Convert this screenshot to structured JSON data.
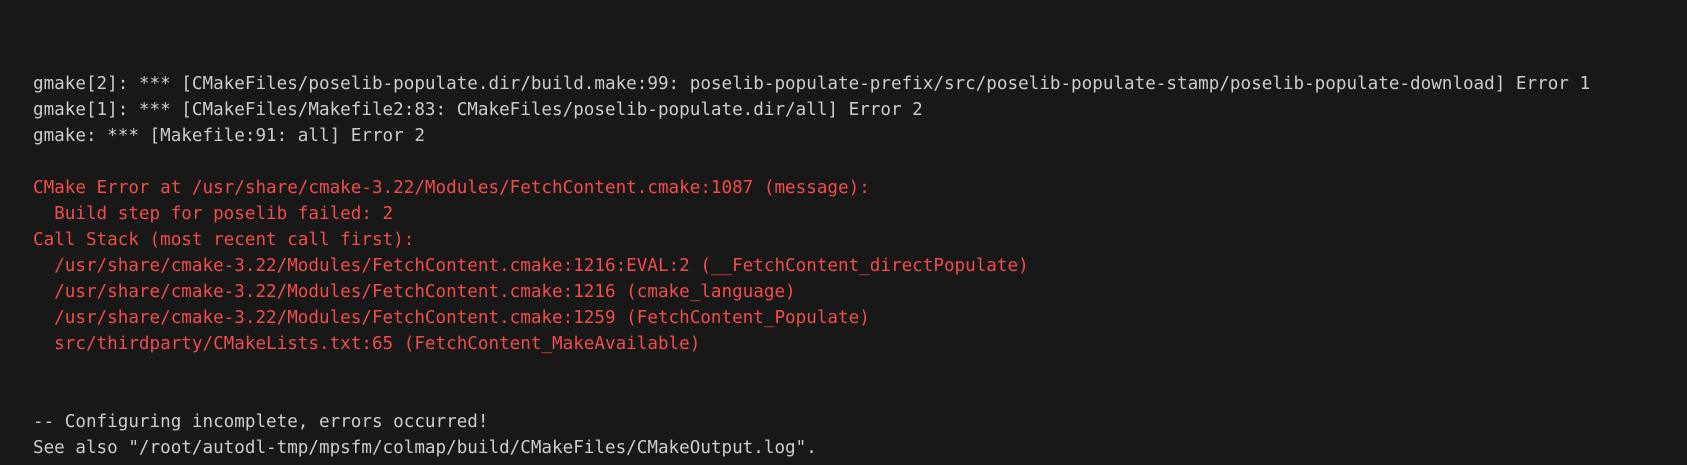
{
  "terminal": {
    "colors": {
      "background": "#181818",
      "normal_text": "#cccccc",
      "error_text": "#f14c4c"
    },
    "lines": [
      {
        "text": "gmake[2]: *** [CMakeFiles/poselib-populate.dir/build.make:99: poselib-populate-prefix/src/poselib-populate-stamp/poselib-populate-download] Error 1",
        "style": "normal"
      },
      {
        "text": "gmake[1]: *** [CMakeFiles/Makefile2:83: CMakeFiles/poselib-populate.dir/all] Error 2",
        "style": "normal"
      },
      {
        "text": "gmake: *** [Makefile:91: all] Error 2",
        "style": "normal"
      },
      {
        "text": "",
        "style": "blank"
      },
      {
        "text": "CMake Error at /usr/share/cmake-3.22/Modules/FetchContent.cmake:1087 (message):",
        "style": "error"
      },
      {
        "text": "  Build step for poselib failed: 2",
        "style": "error"
      },
      {
        "text": "Call Stack (most recent call first):",
        "style": "error"
      },
      {
        "text": "  /usr/share/cmake-3.22/Modules/FetchContent.cmake:1216:EVAL:2 (__FetchContent_directPopulate)",
        "style": "error"
      },
      {
        "text": "  /usr/share/cmake-3.22/Modules/FetchContent.cmake:1216 (cmake_language)",
        "style": "error"
      },
      {
        "text": "  /usr/share/cmake-3.22/Modules/FetchContent.cmake:1259 (FetchContent_Populate)",
        "style": "error"
      },
      {
        "text": "  src/thirdparty/CMakeLists.txt:65 (FetchContent_MakeAvailable)",
        "style": "error"
      },
      {
        "text": "",
        "style": "blank"
      },
      {
        "text": "",
        "style": "blank"
      },
      {
        "text": "-- Configuring incomplete, errors occurred!",
        "style": "normal"
      },
      {
        "text": "See also \"/root/autodl-tmp/mpsfm/colmap/build/CMakeFiles/CMakeOutput.log\".",
        "style": "normal"
      }
    ]
  }
}
